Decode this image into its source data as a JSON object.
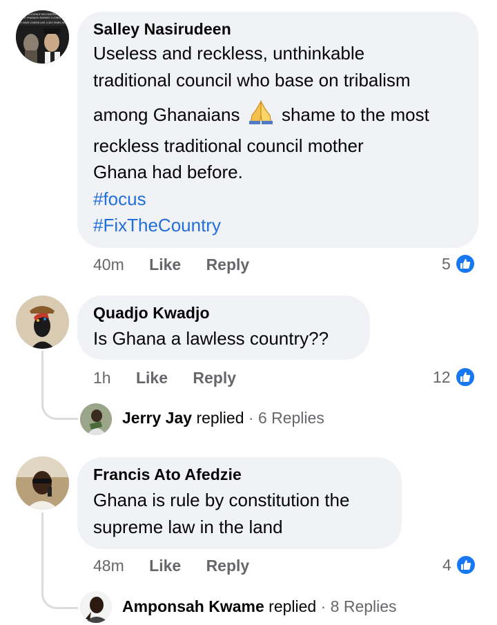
{
  "comments": [
    {
      "author": "Salley Nasirudeen",
      "text_line1": "Useless and reckless, unthinkable",
      "text_line2": "traditional council who base on tribalism",
      "text_line3a": "among Ghanaians",
      "text_line3b": "shame to the most",
      "text_line4": "reckless traditional council mother",
      "text_line5": "Ghana had before.",
      "hashtags": [
        "#focus",
        "#FixTheCountry"
      ],
      "time": "40m",
      "like_label": "Like",
      "reply_label": "Reply",
      "reactions": "5",
      "avatar_caption_1": "AI INTELLIGENCE RECONSTRUCTION",
      "avatar_caption_2": "AT PHARAOH RAMSES II (FIRO)",
      "avatar_caption_3": "MAY HAVE LOOKED LIKE 3,303 YEARS AGO",
      "emoji_icon": "folded-hands-icon"
    },
    {
      "author": "Quadjo Kwadjo",
      "text_line1": "Is Ghana a lawless country??",
      "time": "1h",
      "like_label": "Like",
      "reply_label": "Reply",
      "reactions": "12",
      "reply_preview": {
        "name": "Jerry Jay",
        "action": "replied",
        "sep": "·",
        "count": "6 Replies"
      }
    },
    {
      "author": "Francis Ato Afedzie",
      "text_line1": "Ghana is rule by constitution the",
      "text_line2": "supreme law in the land",
      "time": "48m",
      "like_label": "Like",
      "reply_label": "Reply",
      "reactions": "4",
      "reply_preview": {
        "name": "Amponsah Kwame",
        "action": "replied",
        "sep": "·",
        "count": "8 Replies"
      }
    }
  ],
  "colors": {
    "bubble": "#f0f2f5",
    "link": "#216fdb",
    "meta": "#65676b",
    "like_blue": "#1877f2"
  },
  "icons": {
    "like": "thumbs-up-icon"
  }
}
